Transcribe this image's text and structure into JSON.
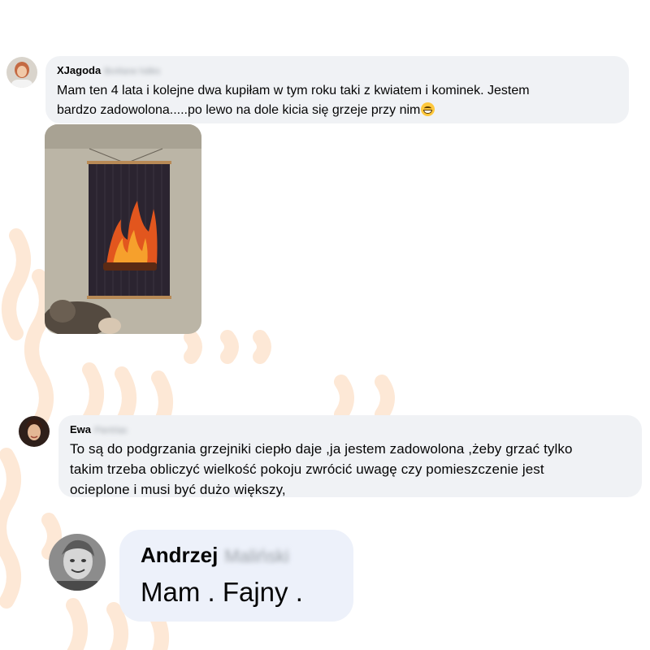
{
  "comments": [
    {
      "author": "XJagoda",
      "author_surname": "Bo4lane hdiks",
      "text": "Mam ten 4 lata i kolejne dwa kupiłam w tym roku taki z kwiatem i kominek. Jestem\nbardzo zadowolona.....po lewo na dole kicia się grzeje przy nim",
      "emoji": "grinning-face",
      "has_photo": true
    },
    {
      "author": "Ewa",
      "author_surname": "Piertrlas",
      "text": "To są do podgrzania grzejniki ciepło daje ,ja jestem zadowolona ,żeby grzać tylko\ntakim trzeba obliczyć wielkość pokoju zwrócić uwagę czy pomieszczenie jest\nocieplone i musi być dużo większy,"
    },
    {
      "author": "Andrzej",
      "author_surname": "Maliński",
      "text": "Mam . Fajny ."
    }
  ],
  "colors": {
    "bubble": "#f0f2f5",
    "bubble_large": "#edf1fa",
    "wave": "#fde9d9"
  }
}
